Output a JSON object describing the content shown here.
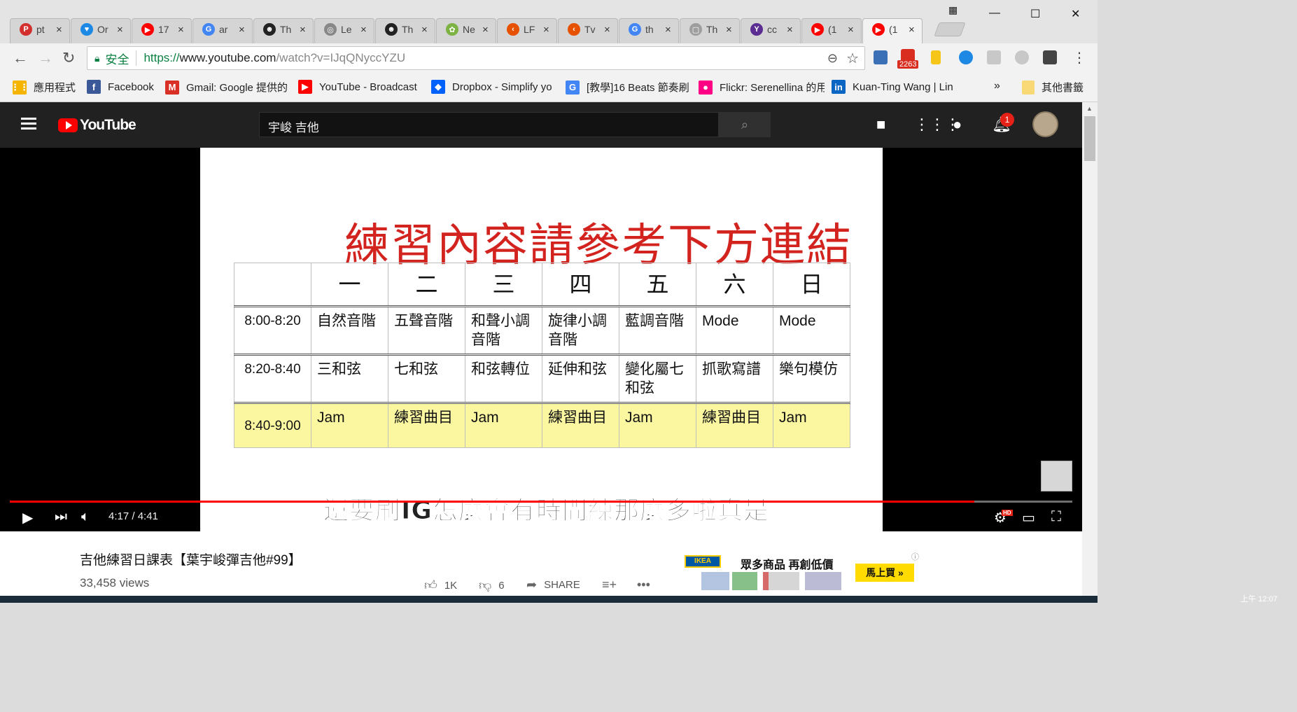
{
  "browser": {
    "tabs": [
      {
        "favicon_color": "#d32f2f",
        "favicon_glyph": "P",
        "title": "pt"
      },
      {
        "favicon_color": "#1e88e5",
        "favicon_glyph": "♥",
        "title": "Or"
      },
      {
        "favicon_color": "#ff0000",
        "favicon_glyph": "▶",
        "title": "17"
      },
      {
        "favicon_color": "#4285f4",
        "favicon_glyph": "G",
        "title": "ar"
      },
      {
        "favicon_color": "#222222",
        "favicon_glyph": "☻",
        "title": "Th"
      },
      {
        "favicon_color": "#888888",
        "favicon_glyph": "◎",
        "title": "Le"
      },
      {
        "favicon_color": "#222222",
        "favicon_glyph": "☻",
        "title": "Th"
      },
      {
        "favicon_color": "#7cb342",
        "favicon_glyph": "✿",
        "title": "Ne"
      },
      {
        "favicon_color": "#e65100",
        "favicon_glyph": "‹",
        "title": "LF"
      },
      {
        "favicon_color": "#e65100",
        "favicon_glyph": "‹",
        "title": "Tv"
      },
      {
        "favicon_color": "#4285f4",
        "favicon_glyph": "G",
        "title": "th"
      },
      {
        "favicon_color": "#9e9e9e",
        "favicon_glyph": "▢",
        "title": "Th"
      },
      {
        "favicon_color": "#5c2d91",
        "favicon_glyph": "Y",
        "title": "cc"
      },
      {
        "favicon_color": "#ff0000",
        "favicon_glyph": "▶",
        "title": "(1"
      },
      {
        "favicon_color": "#ff0000",
        "favicon_glyph": "▶",
        "title": "(1"
      }
    ],
    "close_glyph": "×",
    "window_buttons": {
      "minimize": "—",
      "maximize": "☐",
      "close": "✕"
    },
    "nav": {
      "back": "←",
      "forward": "→",
      "reload": "↻"
    },
    "omnibox": {
      "secure_label": "安全",
      "url_scheme": "https://",
      "url_host": "www.youtube.com",
      "url_path": "/watch?v=IJqQNyccYZU"
    },
    "extensions": {
      "mail_count": "2263"
    },
    "bookmarks": [
      {
        "icon": "apps-grid-icon",
        "color": "#f4b400",
        "glyph": "⋮⋮",
        "label": "應用程式"
      },
      {
        "icon": "facebook-icon",
        "color": "#3b5998",
        "glyph": "f",
        "label": "Facebook"
      },
      {
        "icon": "gmail-icon",
        "color": "#d93025",
        "glyph": "M",
        "label": "Gmail: Google 提供的"
      },
      {
        "icon": "youtube-icon",
        "color": "#ff0000",
        "glyph": "▶",
        "label": "YouTube - Broadcast"
      },
      {
        "icon": "dropbox-icon",
        "color": "#0061ff",
        "glyph": "◆",
        "label": "Dropbox - Simplify yo"
      },
      {
        "icon": "google-icon",
        "color": "#4285f4",
        "glyph": "G",
        "label": "[教學]16 Beats 節奏刷"
      },
      {
        "icon": "flickr-icon",
        "color": "#ff0084",
        "glyph": "●",
        "label": "Flickr: Serenellina 的用"
      },
      {
        "icon": "linkedin-icon",
        "color": "#0a66c2",
        "glyph": "in",
        "label": "Kuan-Ting Wang | Lin"
      }
    ],
    "bookmarks_overflow": "»",
    "other_bookmarks": "其他書籤"
  },
  "youtube": {
    "logo_text": "YouTube",
    "search_query": "宇峻 吉他",
    "notification_count": "1",
    "player": {
      "slide": {
        "title": "練習內容請參考下方連結",
        "days": [
          "一",
          "二",
          "三",
          "四",
          "五",
          "六",
          "日"
        ],
        "rows": [
          {
            "time": "8:00-8:20",
            "cells": [
              "自然音階",
              "五聲音階",
              "和聲小調音階",
              "旋律小調音階",
              "藍調音階",
              "Mode",
              "Mode"
            ]
          },
          {
            "time": "8:20-8:40",
            "cells": [
              "三和弦",
              "七和弦",
              "和弦轉位",
              "延伸和弦",
              "變化屬七和弦",
              "抓歌寫譜",
              "樂句模仿"
            ]
          },
          {
            "time": "8:40-9:00",
            "cells": [
              "Jam",
              "練習曲目",
              "Jam",
              "練習曲目",
              "Jam",
              "練習曲目",
              "Jam"
            ]
          }
        ]
      },
      "subtitle": "還要刷IG怎麼會有時間練那麼多啦真是",
      "current_time": "4:17",
      "duration": "4:41",
      "time_display": "4:17 / 4:41",
      "progress_fraction": 0.9075,
      "hd_badge": "HD"
    },
    "video": {
      "title": "吉他練習日課表【葉宇峻彈吉他#99】",
      "views": "33,458 views",
      "likes": "1K",
      "dislikes": "6",
      "share_label": "SHARE"
    },
    "ad": {
      "brand": "IKEA",
      "headline": "眾多商品 再創低價",
      "cta": "馬上買 »",
      "info": "ⓘ"
    }
  },
  "taskbar": {
    "clock": "上午 12:07"
  }
}
